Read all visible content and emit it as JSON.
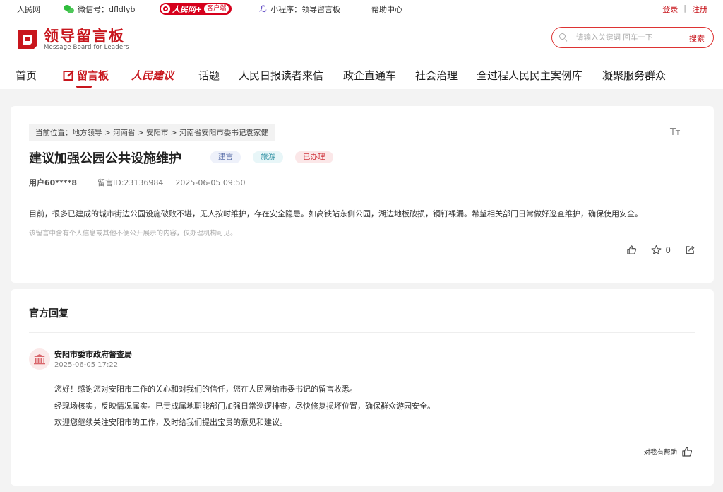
{
  "topbar": {
    "site": "人民网",
    "wechat_label": "微信号：dfldlyb",
    "app_name": "人民网+",
    "app_badge": "客户端",
    "miniprogram": "小程序：领导留言板",
    "help": "帮助中心",
    "login": "登录",
    "sep": "|",
    "register": "注册"
  },
  "header": {
    "logo_cn": "领导留言板",
    "logo_en": "Message Board for Leaders",
    "search_placeholder": "请输入关键词 回车一下",
    "search_btn": "搜索"
  },
  "nav": [
    {
      "label": "首页"
    },
    {
      "label": "留言板"
    },
    {
      "label": "人民建议"
    },
    {
      "label": "话题"
    },
    {
      "label": "人民日报读者来信"
    },
    {
      "label": "政企直通车"
    },
    {
      "label": "社会治理"
    },
    {
      "label": "全过程人民民主案例库"
    },
    {
      "label": "凝聚服务群众"
    }
  ],
  "message": {
    "breadcrumb": "当前位置：地方领导 > 河南省 > 安阳市 > 河南省安阳市委书记袁家健",
    "font_toggle": "TT",
    "title": "建议加强公园公共设施维护",
    "tags": [
      "建言",
      "旅游",
      "已办理"
    ],
    "user": "用户60****8",
    "msg_id": "留言ID:23136984",
    "time": "2025-06-05 09:50",
    "content": "目前，很多已建成的城市街边公园设施破败不堪，无人按时维护，存在安全隐患。如高铁站东侧公园，湖边地板破损，钢钉裸漏。希望相关部门日常做好巡查维护，确保使用安全。",
    "privacy_note": "该留言中含有个人信息或其他不便公开展示的内容，仅办理机构可见。",
    "fav_count": "0"
  },
  "reply": {
    "heading": "官方回复",
    "org": "安阳市委市政府督查局",
    "time": "2025-06-05 17:22",
    "lines": [
      "您好！感谢您对安阳市工作的关心和对我们的信任，您在人民网给市委书记的留言收悉。",
      "经现场核实，反映情况属实。已责成属地职能部门加强日常巡逻排查，尽快修复损坏位置，确保群众游园安全。",
      "欢迎您继续关注安阳市的工作，及时给我们提出宝贵的意见和建议。"
    ],
    "helpful": "对我有帮助"
  },
  "colors": {
    "brand": "#c8161d",
    "tag_blue": "#eef1fa",
    "tag_cyan": "#e8f6f8",
    "tag_red": "#fbe7e8"
  }
}
